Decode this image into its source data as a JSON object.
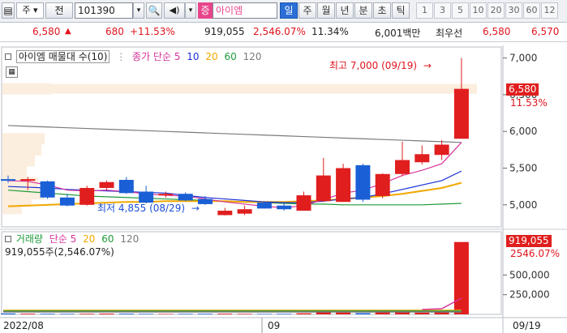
{
  "toolbar": {
    "market_label": "주",
    "prev_label": "전",
    "code": "101390",
    "stock_badge": "증",
    "stock_name": "아이엠",
    "timeframes": [
      "일",
      "주",
      "월",
      "년",
      "분",
      "초",
      "틱"
    ],
    "active_timeframe": 0,
    "periods": [
      "1",
      "3",
      "5",
      "10",
      "20",
      "30",
      "60",
      "12"
    ]
  },
  "quote": {
    "price": "6,580",
    "change": "680",
    "change_pct": "+11.53%",
    "volume": "919,055",
    "volume_ratio": "2,546.07%",
    "turnover": "11.34%",
    "trade_value": "6,001백만",
    "best_ask_label": "최우선",
    "best_ask": "6,580",
    "best_bid": "6,570"
  },
  "price_panel": {
    "legend_title": "아이엠 매물대 수(10)",
    "ma_label": "종가 단순 5",
    "ma_periods": [
      "10",
      "20",
      "60",
      "120"
    ],
    "ma_colors": [
      "#d6339b",
      "#1a2fd6",
      "#f0a800",
      "#1f9b3a",
      "#7a7a7a"
    ],
    "high_annotation": "최고 7,000 (09/19)",
    "low_annotation": "최저 4,855 (08/29)",
    "current_price": "6,580",
    "current_pct": "11.53%",
    "y_ticks": [
      "7,000",
      "6,500",
      "6,000",
      "5,500",
      "5,000"
    ]
  },
  "volume_panel": {
    "legend_title": "거래량",
    "ma_label": "단순 5",
    "ma_periods": [
      "20",
      "60",
      "120"
    ],
    "volume_text": "919,055주(2,546.07%)",
    "current_volume": "919,055",
    "current_pct": "2546.07%",
    "y_ticks": [
      "500,000",
      "250,000"
    ]
  },
  "x_axis": {
    "labels": [
      "2022/08",
      "09"
    ],
    "cursor_date": "09/19"
  },
  "colors": {
    "up": "#e01e1e",
    "down": "#1a5fd6",
    "accent": "#2c6fd6"
  },
  "chart_data": {
    "type": "candlestick",
    "dates_start": "2022/08",
    "candles": [
      {
        "o": 5350,
        "h": 5400,
        "l": 5300,
        "c": 5330
      },
      {
        "o": 5340,
        "h": 5380,
        "l": 5200,
        "c": 5350
      },
      {
        "o": 5320,
        "h": 5330,
        "l": 5080,
        "c": 5100
      },
      {
        "o": 5100,
        "h": 5150,
        "l": 4980,
        "c": 4990
      },
      {
        "o": 5000,
        "h": 5260,
        "l": 4990,
        "c": 5230
      },
      {
        "o": 5230,
        "h": 5330,
        "l": 5200,
        "c": 5310
      },
      {
        "o": 5340,
        "h": 5380,
        "l": 5150,
        "c": 5160
      },
      {
        "o": 5180,
        "h": 5260,
        "l": 5020,
        "c": 5030
      },
      {
        "o": 5130,
        "h": 5180,
        "l": 5100,
        "c": 5150
      },
      {
        "o": 5150,
        "h": 5170,
        "l": 5050,
        "c": 5060
      },
      {
        "o": 5080,
        "h": 5120,
        "l": 5000,
        "c": 5010
      },
      {
        "o": 4860,
        "h": 4960,
        "l": 4855,
        "c": 4920
      },
      {
        "o": 4880,
        "h": 4990,
        "l": 4860,
        "c": 4940
      },
      {
        "o": 5030,
        "h": 5050,
        "l": 4950,
        "c": 4950
      },
      {
        "o": 4990,
        "h": 5030,
        "l": 4920,
        "c": 4940
      },
      {
        "o": 4920,
        "h": 5180,
        "l": 4920,
        "c": 5130
      },
      {
        "o": 5050,
        "h": 5640,
        "l": 5040,
        "c": 5400
      },
      {
        "o": 5040,
        "h": 5560,
        "l": 5040,
        "c": 5500
      },
      {
        "o": 5540,
        "h": 5560,
        "l": 5040,
        "c": 5070
      },
      {
        "o": 5120,
        "h": 5430,
        "l": 5090,
        "c": 5420
      },
      {
        "o": 5420,
        "h": 5860,
        "l": 5390,
        "c": 5610
      },
      {
        "o": 5580,
        "h": 5810,
        "l": 5550,
        "c": 5690
      },
      {
        "o": 5680,
        "h": 5880,
        "l": 5610,
        "c": 5820
      },
      {
        "o": 5900,
        "h": 7000,
        "l": 5950,
        "c": 6580
      }
    ],
    "ma5": [
      5330,
      5320,
      5270,
      5200,
      5190,
      5200,
      5180,
      5150,
      5130,
      5120,
      5080,
      5040,
      5010,
      4980,
      4960,
      4990,
      5070,
      5160,
      5200,
      5290,
      5400,
      5470,
      5560,
      5850
    ],
    "ma10": [
      5250,
      5240,
      5230,
      5210,
      5200,
      5190,
      5180,
      5170,
      5160,
      5130,
      5100,
      5080,
      5060,
      5040,
      5030,
      5030,
      5050,
      5080,
      5100,
      5150,
      5210,
      5270,
      5330,
      5460
    ],
    "ma20": [
      4980,
      4990,
      5000,
      5010,
      5020,
      5030,
      5040,
      5040,
      5050,
      5050,
      5050,
      5050,
      5040,
      5040,
      5040,
      5050,
      5060,
      5080,
      5100,
      5120,
      5150,
      5190,
      5230,
      5300
    ],
    "ma60": [
      5200,
      5180,
      5160,
      5140,
      5120,
      5110,
      5100,
      5090,
      5080,
      5070,
      5060,
      5050,
      5040,
      5030,
      5020,
      5010,
      5010,
      5000,
      5000,
      5000,
      5000,
      5000,
      5010,
      5020
    ],
    "ma120": [
      6080,
      6070,
      6060,
      6050,
      6040,
      6030,
      6020,
      6010,
      6000,
      5990,
      5980,
      5970,
      5960,
      5950,
      5940,
      5930,
      5920,
      5910,
      5900,
      5890,
      5880,
      5870,
      5860,
      5850
    ],
    "volumes": [
      12000,
      9000,
      8000,
      7000,
      8000,
      10000,
      9000,
      7000,
      6000,
      7000,
      8000,
      9000,
      7000,
      6000,
      7000,
      14000,
      38000,
      24000,
      16000,
      30000,
      33000,
      22000,
      27000,
      919055
    ],
    "y_range": [
      4700,
      7150
    ],
    "volume_range": [
      0,
      1050000
    ]
  }
}
